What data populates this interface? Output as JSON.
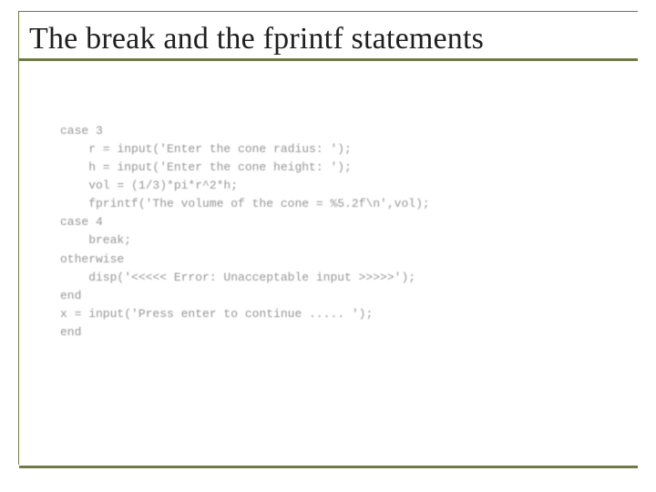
{
  "slide": {
    "title": "The break and the fprintf statements"
  },
  "code": {
    "l1": "case 3",
    "l2": "    r = input('Enter the cone radius: ');",
    "l3": "    h = input('Enter the cone height: ');",
    "l4": "    vol = (1/3)*pi*r^2*h;",
    "l5": "    fprintf('The volume of the cone = %5.2f\\n',vol);",
    "l6": "case 4",
    "l7": "    break;",
    "l8": "otherwise",
    "l9": "    disp('<<<<< Error: Unacceptable input >>>>>');",
    "l10": "end",
    "l11": "x = input('Press enter to continue ..... ');",
    "l12": "end"
  }
}
